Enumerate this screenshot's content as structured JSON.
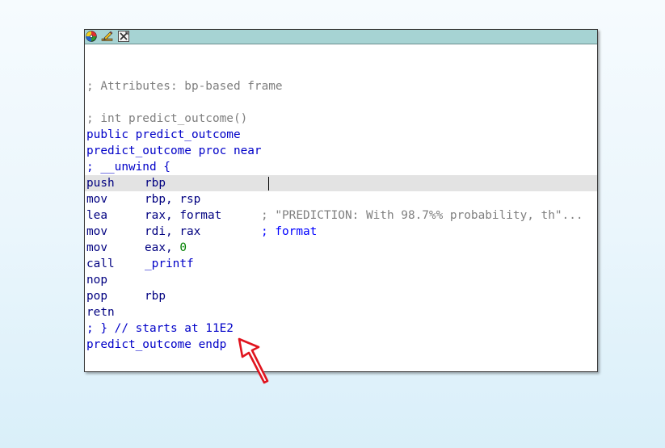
{
  "window": {
    "toolbar_icons": [
      "graph-icon",
      "edit-icon",
      "close-icon"
    ]
  },
  "listing": {
    "attributes_comment": "; Attributes: bp-based frame",
    "signature_comment": "; int predict_outcome()",
    "public_decl": "public predict_outcome",
    "proc_decl": "predict_outcome proc near",
    "unwind_open": "; __unwind {",
    "instructions": [
      {
        "mnemonic": "push",
        "operands": "rbp",
        "comment": ""
      },
      {
        "mnemonic": "mov",
        "operands": "rbp, rsp",
        "comment": ""
      },
      {
        "mnemonic": "lea",
        "operands": "rax, format",
        "comment": "; \"PREDICTION: With 98.7%% probability, th\"..."
      },
      {
        "mnemonic": "mov",
        "operands": "rdi, rax",
        "comment": "; format"
      },
      {
        "mnemonic": "mov",
        "operands_reg": "eax, ",
        "operands_imm": "0",
        "comment": ""
      },
      {
        "mnemonic": "call",
        "operands": "_printf",
        "comment": ""
      },
      {
        "mnemonic": "nop",
        "operands": "",
        "comment": ""
      },
      {
        "mnemonic": "pop",
        "operands": "rbp",
        "comment": ""
      },
      {
        "mnemonic": "retn",
        "operands": "",
        "comment": ""
      }
    ],
    "unwind_close": "; } // starts at 11E2",
    "endp_decl": "predict_outcome endp"
  },
  "colors": {
    "titlebar": "#a6d3d3",
    "keyword_blue": "#0000c8",
    "comment_gray": "#7f7f7f",
    "immediate_green": "#008000",
    "highlight_row": "#e3e3e3",
    "annotation_arrow": "#e0141e"
  }
}
